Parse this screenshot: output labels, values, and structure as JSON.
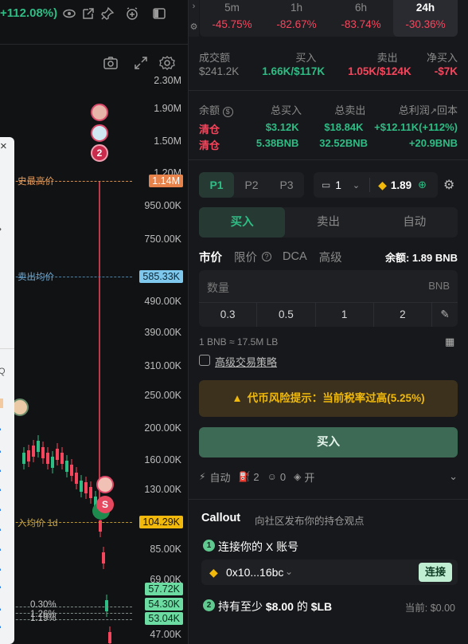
{
  "topbar": {
    "change_pct": "+112.08%)"
  },
  "chart": {
    "price_levels": [
      "2.30M",
      "1.90M",
      "1.50M",
      "1.20M",
      "950.00K",
      "750.00K",
      "490.00K",
      "390.00K",
      "310.00K",
      "250.00K",
      "200.00K",
      "160.00K",
      "130.00K",
      "85.00K",
      "69.00K",
      "47.00K"
    ],
    "ath_label": "史最高价",
    "ath_tag": "1.14M",
    "sell_avg_label": "卖出均价",
    "sell_avg_tag": "585.33K",
    "buy_avg_label": "入均价 1d",
    "buy_avg_tag": "104.29K",
    "bottom_tags": [
      "57.72K",
      "54.30K",
      "53.04K"
    ],
    "pct_marks": [
      "0.30%",
      "1.26%",
      "1.19%"
    ],
    "marker_badge_count": "2",
    "marker_s": "S",
    "popup_close": "×",
    "popup_search": "Q"
  },
  "timeframes": [
    {
      "label": "5m",
      "change": "-45.75%",
      "active": false
    },
    {
      "label": "1h",
      "change": "-82.67%",
      "active": false
    },
    {
      "label": "6h",
      "change": "-83.74%",
      "active": false
    },
    {
      "label": "24h",
      "change": "-30.36%",
      "active": true
    }
  ],
  "volume_stats": {
    "headers": [
      "成交额",
      "买入",
      "卖出",
      "净买入"
    ],
    "turnover": "$241.2K",
    "buy_count": "1.66K",
    "buy_value": "/$117K",
    "sell_count": "1.05K",
    "sell_value": "/$124K",
    "net_buy": "-$7K"
  },
  "holdings": {
    "headers": [
      "余额",
      "总买入",
      "总卖出",
      "总利润",
      "回本"
    ],
    "rows": [
      {
        "balance": "清仓",
        "total_buy": "$3.12K",
        "total_sell": "$18.84K",
        "profit": "+$12.11K(+112%)"
      },
      {
        "balance": "清仓",
        "total_buy": "5.38BNB",
        "total_sell": "32.52BNB",
        "profit": "+20.9BNB"
      }
    ]
  },
  "presets": {
    "tabs": [
      "P1",
      "P2",
      "P3"
    ],
    "active": "P1",
    "wallet_count": "1",
    "bnb_balance": "1.89"
  },
  "trade_tabs": {
    "items": [
      "买入",
      "卖出",
      "自动"
    ],
    "active": "买入"
  },
  "order_types": {
    "items": [
      "市价",
      "限价",
      "DCA",
      "高级"
    ],
    "active": "市价",
    "balance_label": "余额: 1.89 BNB"
  },
  "quantity": {
    "placeholder": "数量",
    "unit": "BNB",
    "quick": [
      "0.3",
      "0.5",
      "1",
      "2"
    ]
  },
  "conversion": "1 BNB ≈ 17.5M LB",
  "advanced_strategy": "高级交易策略",
  "warning": "代币风险提示：当前税率过高(5.25%)",
  "buy_button": "买入",
  "footer_opts": {
    "auto": "自动",
    "count_a": "2",
    "count_b": "0",
    "toggle": "开"
  },
  "callout": {
    "title": "Callout",
    "subtitle": "向社区发布你的持仓观点",
    "step1": "连接你的 X 账号",
    "wallet": "0x10...16bc",
    "connect": "连接",
    "step2_prefix": "持有至少",
    "step2_amount": "$8.00",
    "step2_of": "的",
    "step2_token": "$LB",
    "current": "当前: $0.00"
  },
  "colors": {
    "up": "#2ebd85",
    "down": "#f6465d",
    "accent": "#f0b90b"
  }
}
